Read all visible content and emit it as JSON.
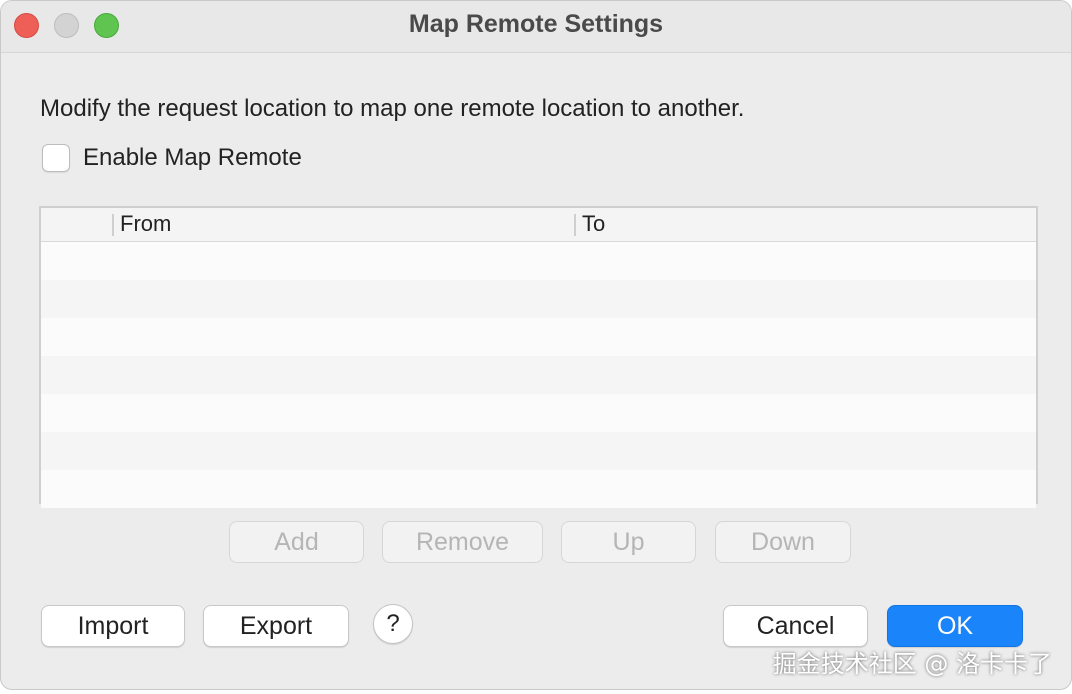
{
  "window": {
    "title": "Map Remote Settings"
  },
  "description": "Modify the request location to map one remote location to another.",
  "enable": {
    "label": "Enable Map Remote",
    "checked": false
  },
  "table": {
    "columns": [
      "",
      "From",
      "To"
    ],
    "rows": []
  },
  "table_actions": {
    "add": "Add",
    "remove": "Remove",
    "up": "Up",
    "down": "Down"
  },
  "footer": {
    "import": "Import",
    "export": "Export",
    "help": "?",
    "cancel": "Cancel",
    "ok": "OK"
  },
  "watermark": "掘金技术社区 @ 洛卡卡了"
}
